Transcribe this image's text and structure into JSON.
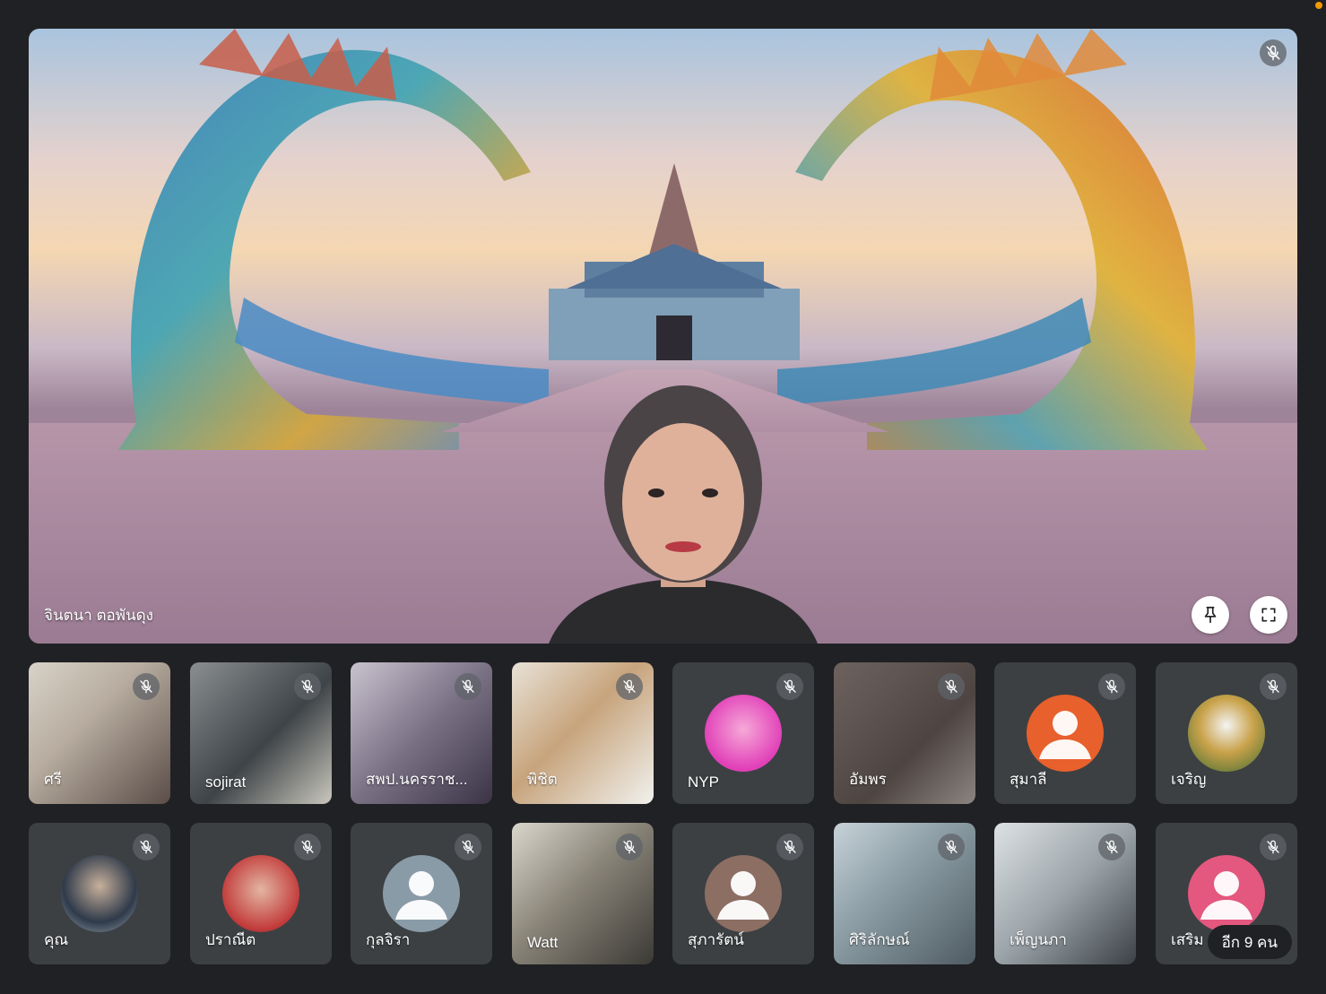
{
  "main": {
    "name": "จินตนา ตอพันดุง",
    "muted": true,
    "pin_icon": "pin-icon",
    "fullscreen_icon": "fullscreen-icon"
  },
  "participants": [
    {
      "name": "ศรี",
      "kind": "video",
      "muted": true
    },
    {
      "name": "sojirat",
      "kind": "video",
      "muted": true
    },
    {
      "name": "สพป.นครราช...",
      "kind": "video",
      "muted": true
    },
    {
      "name": "พิชิต",
      "kind": "video",
      "muted": true
    },
    {
      "name": "NYP",
      "kind": "avatar-image",
      "muted": true
    },
    {
      "name": "อัมพร",
      "kind": "video",
      "muted": true
    },
    {
      "name": "สุมาลี",
      "kind": "avatar-default",
      "avatar_color": "#e8602c",
      "muted": true
    },
    {
      "name": "เจริญ",
      "kind": "avatar-image",
      "muted": true
    },
    {
      "name": "คุณ",
      "kind": "avatar-image",
      "muted": true
    },
    {
      "name": "ปราณีต",
      "kind": "avatar-image",
      "muted": true
    },
    {
      "name": "กุลจิรา",
      "kind": "avatar-default",
      "avatar_color": "#8a9ba8",
      "muted": true
    },
    {
      "name": "Watt",
      "kind": "video",
      "muted": true
    },
    {
      "name": "สุภารัตน์",
      "kind": "avatar-default",
      "avatar_color": "#8d6e63",
      "muted": true
    },
    {
      "name": "ศิริลักษณ์",
      "kind": "video",
      "muted": true
    },
    {
      "name": "เพ็ญนภา",
      "kind": "video",
      "muted": true
    },
    {
      "name": "เสริม",
      "kind": "avatar-default",
      "avatar_color": "#e4577e",
      "muted": true
    }
  ],
  "more_label": "อีก 9 คน",
  "colors": {
    "background": "#202124",
    "tile": "#3c4043",
    "mute_badge": "#5f6368"
  }
}
